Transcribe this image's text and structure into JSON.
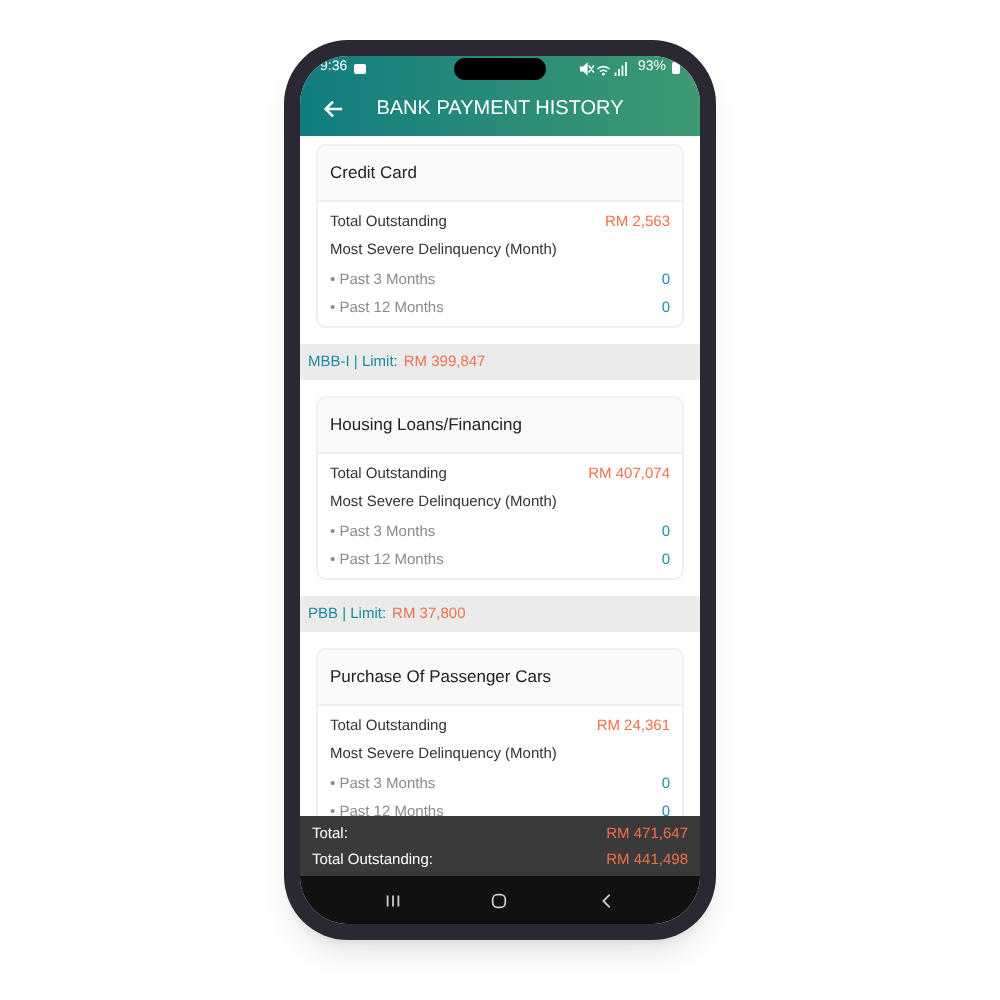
{
  "status_bar": {
    "time": "9:36",
    "battery": "93%"
  },
  "header": {
    "title": "BANK PAYMENT HISTORY"
  },
  "sections": [
    {
      "card": {
        "title": "Credit Card",
        "total_label": "Total Outstanding",
        "total_value": "RM 2,563",
        "delinquency_label": "Most Severe Delinquency (Month)",
        "rows": [
          {
            "label": "• Past 3 Months",
            "value": "0"
          },
          {
            "label": "• Past 12 Months",
            "value": "0"
          }
        ]
      }
    },
    {
      "lender": "MBB-I | Limit:",
      "limit": "RM 399,847",
      "card": {
        "title": "Housing Loans/Financing",
        "total_label": "Total Outstanding",
        "total_value": "RM 407,074",
        "delinquency_label": "Most Severe Delinquency (Month)",
        "rows": [
          {
            "label": "• Past 3 Months",
            "value": "0"
          },
          {
            "label": "• Past 12 Months",
            "value": "0"
          }
        ]
      }
    },
    {
      "lender": "PBB | Limit:",
      "limit": "RM 37,800",
      "card": {
        "title": "Purchase Of Passenger Cars",
        "total_label": "Total Outstanding",
        "total_value": "RM 24,361",
        "delinquency_label": "Most Severe Delinquency (Month)",
        "rows": [
          {
            "label": "• Past 3 Months",
            "value": "0"
          },
          {
            "label": "• Past 12 Months",
            "value": "0"
          }
        ]
      }
    }
  ],
  "footer": [
    {
      "label": "Total:",
      "value": "RM 471,647"
    },
    {
      "label": "Total Outstanding:",
      "value": "RM 441,498"
    }
  ]
}
